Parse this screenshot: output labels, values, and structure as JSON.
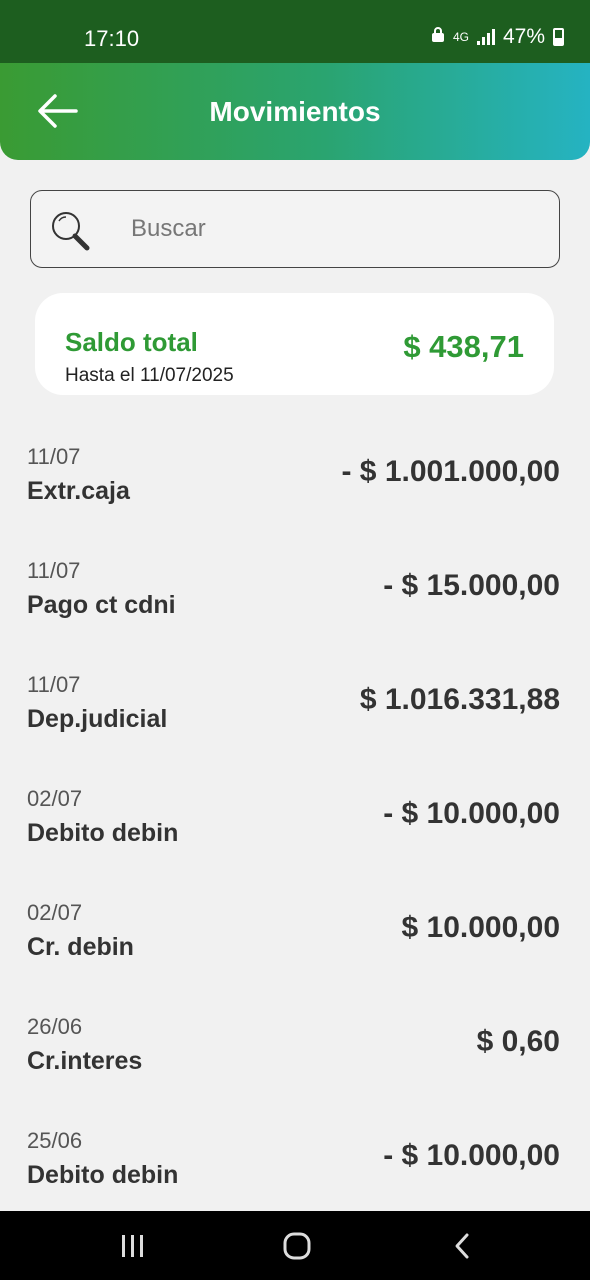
{
  "status_bar": {
    "time": "17:10",
    "network": "4G",
    "battery": "47%"
  },
  "header": {
    "title": "Movimientos"
  },
  "search": {
    "placeholder": "Buscar"
  },
  "balance": {
    "label": "Saldo total",
    "date_text": "Hasta el 11/07/2025",
    "amount": "$ 438,71"
  },
  "transactions": [
    {
      "date": "11/07",
      "description": "Extr.caja",
      "amount": "-  $ 1.001.000,00"
    },
    {
      "date": "11/07",
      "description": "Pago ct cdni",
      "amount": "-  $ 15.000,00"
    },
    {
      "date": "11/07",
      "description": "Dep.judicial",
      "amount": "$ 1.016.331,88"
    },
    {
      "date": "02/07",
      "description": "Debito debin",
      "amount": "-  $ 10.000,00"
    },
    {
      "date": "02/07",
      "description": "Cr. debin",
      "amount": "$ 10.000,00"
    },
    {
      "date": "26/06",
      "description": "Cr.interes",
      "amount": "$ 0,60"
    },
    {
      "date": "25/06",
      "description": "Debito debin",
      "amount": "-  $ 10.000,00"
    }
  ],
  "colors": {
    "accent_green": "#2f9a35",
    "status_bar": "#1d5e1f",
    "header_gradient_start": "#3a9b33",
    "header_gradient_end": "#25b3c2"
  },
  "icons": {
    "back": "arrow-left-icon",
    "search": "magnifier-icon",
    "recents": "recent-apps-icon",
    "home": "home-icon",
    "nav_back": "chevron-left-icon"
  }
}
